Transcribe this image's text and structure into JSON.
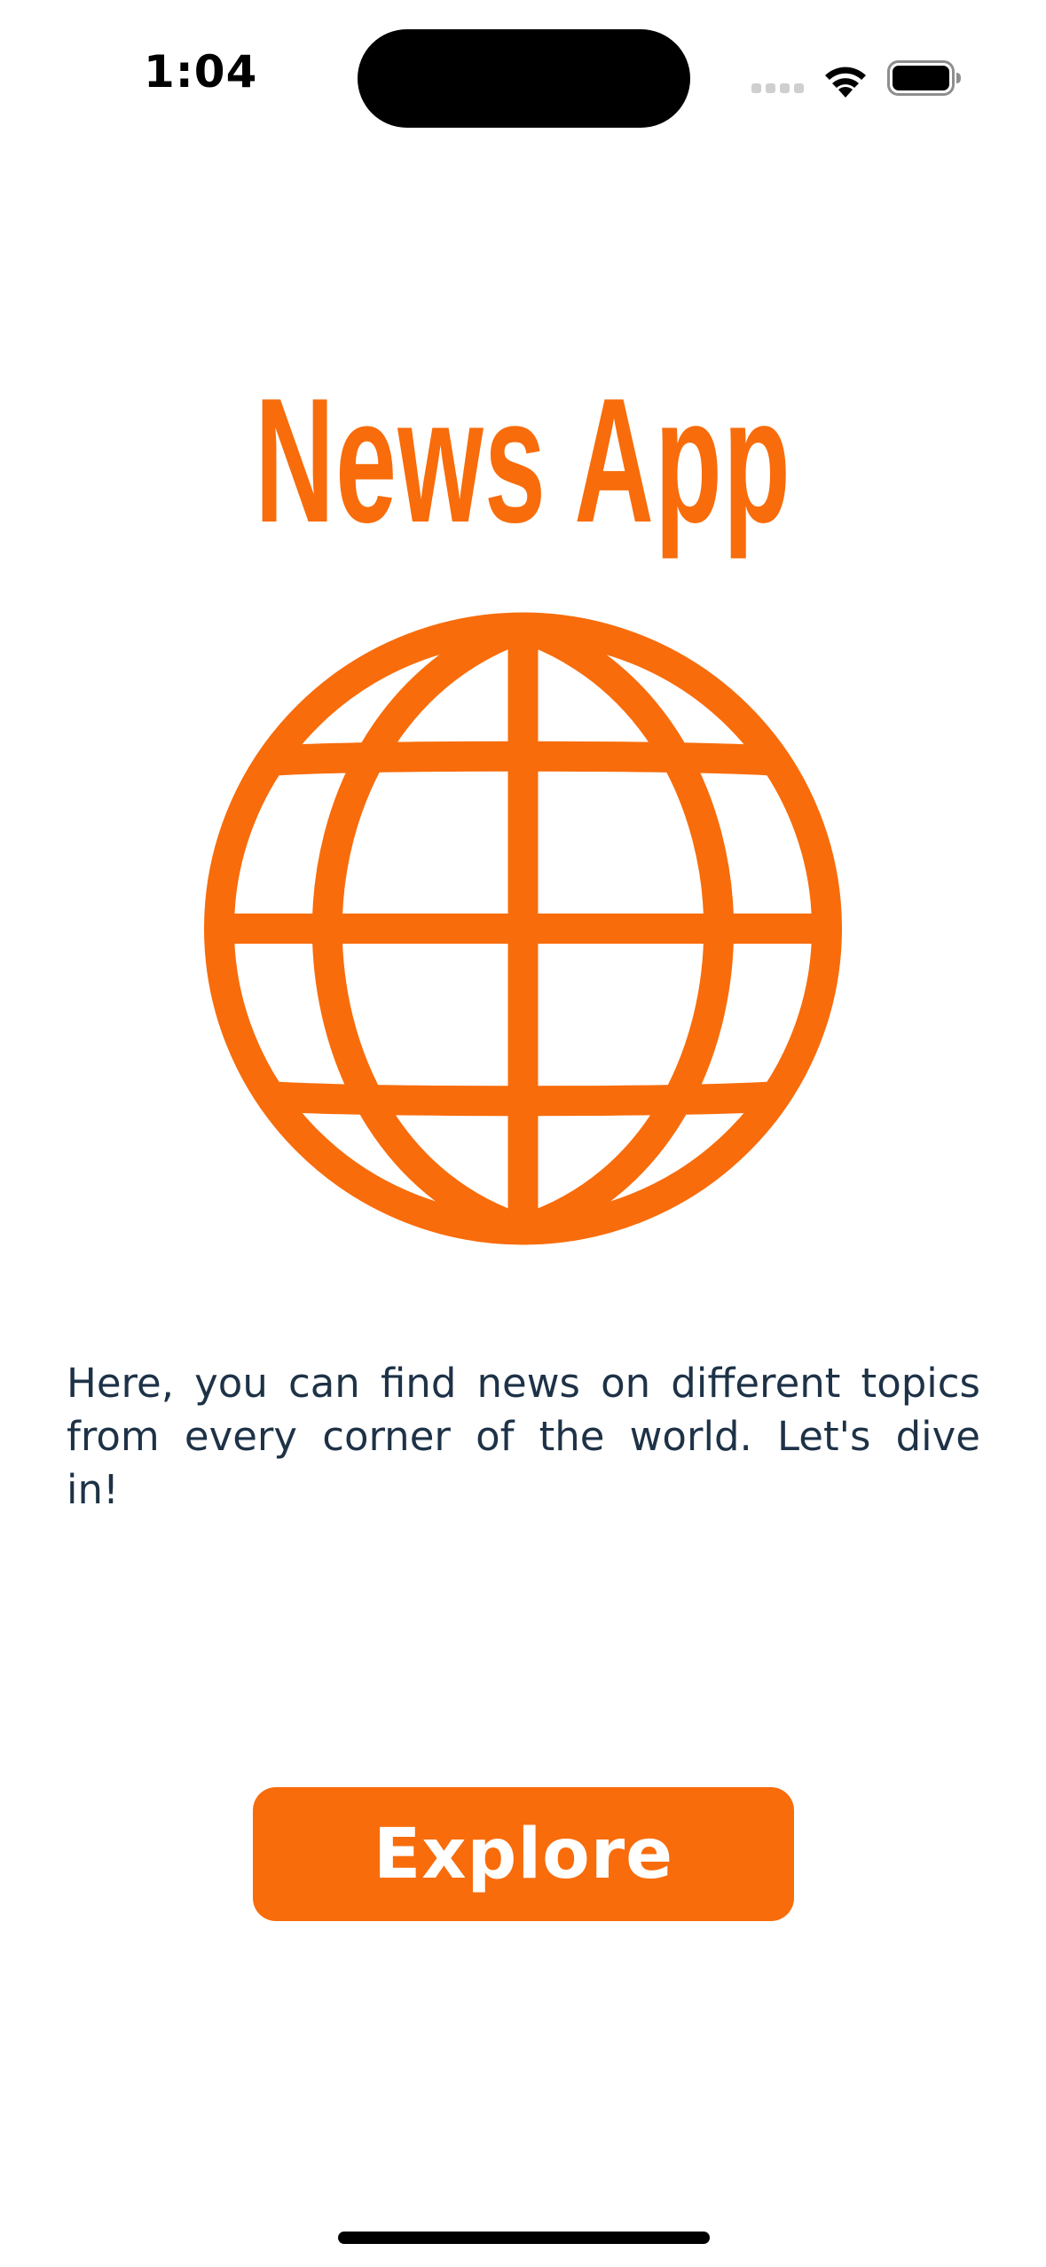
{
  "status_bar": {
    "time": "1:04",
    "icons": [
      "cellular-signal-icon",
      "wifi-icon",
      "battery-icon"
    ]
  },
  "app": {
    "title": "News App",
    "logo_icon": "globe-icon",
    "description": "Here, you can find news on different topics from every corner of the world. Let's dive in!",
    "explore_label": "Explore"
  },
  "colors": {
    "accent": "#f86c0b",
    "text": "#1e3247",
    "background": "#ffffff"
  }
}
